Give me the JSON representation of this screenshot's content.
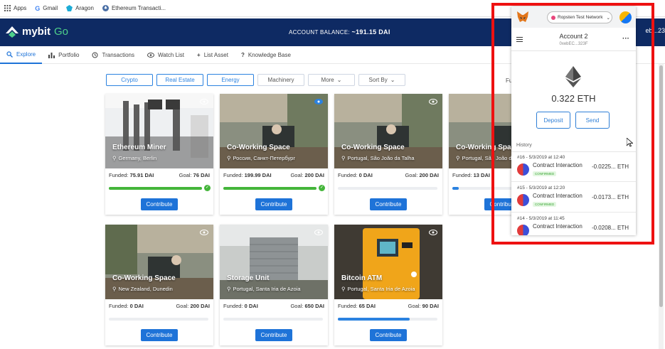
{
  "bookmarks": [
    {
      "label": "Apps",
      "icon": "apps-grid-icon"
    },
    {
      "label": "Gmail",
      "icon": "google-icon"
    },
    {
      "label": "Aragon",
      "icon": "aragon-icon"
    },
    {
      "label": "Ethereum Transacti...",
      "icon": "ethereum-icon"
    }
  ],
  "header": {
    "logo_text": "mybit",
    "logo_suffix": "Go",
    "balance_label": "ACCOUNT BALANCE:",
    "balance_value": "~191.15 DAI",
    "account_partial": "eb...23"
  },
  "nav": [
    {
      "label": "Explore",
      "icon": "search-icon",
      "active": true
    },
    {
      "label": "Portfolio",
      "icon": "bar-chart-icon"
    },
    {
      "label": "Transactions",
      "icon": "history-icon"
    },
    {
      "label": "Watch List",
      "icon": "eye-icon"
    },
    {
      "label": "List Asset",
      "icon": "plus-icon"
    },
    {
      "label": "Knowledge Base",
      "icon": "question-icon"
    }
  ],
  "filters": [
    {
      "label": "Crypto",
      "selected": true
    },
    {
      "label": "Real Estate",
      "selected": true
    },
    {
      "label": "Energy",
      "selected": true
    },
    {
      "label": "Machinery",
      "selected": false
    },
    {
      "label": "More",
      "selected": false,
      "dropdown": true
    },
    {
      "label": "Sort By",
      "selected": false,
      "dropdown": true
    }
  ],
  "filter_extra": "Fu",
  "cards": [
    {
      "title": "Ethereum Miner",
      "location": "Germany, Berlin",
      "funded_label": "Funded:",
      "funded": "75.91 DAI",
      "goal_label": "Goal:",
      "goal": "76 DAI",
      "progress": 0.999,
      "complete": true,
      "button": "Contribute",
      "image": "miner"
    },
    {
      "title": "Co-Working Space",
      "location": "Россия, Санкт-Петербург",
      "funded_label": "Funded:",
      "funded": "199.99 DAI",
      "goal_label": "Goal:",
      "goal": "200 DAI",
      "progress": 0.9999,
      "complete": true,
      "button": "Contribute",
      "image": "cowork",
      "watch": true
    },
    {
      "title": "Co-Working Space",
      "location": "Portugal, São João da Talha",
      "funded_label": "Funded:",
      "funded": "0 DAI",
      "goal_label": "Goal:",
      "goal": "200 DAI",
      "progress": 0,
      "complete": false,
      "button": "Contribute",
      "image": "cowork"
    },
    {
      "title": "Co-Working Space",
      "location": "Portugal, São João da T",
      "funded_label": "Funded:",
      "funded": "13 DAI",
      "goal_label": "Goal:",
      "goal": "",
      "progress": 0.065,
      "complete": false,
      "button": "Contribute",
      "image": "cowork"
    },
    {
      "title": "Co-Working Space",
      "location": "New Zealand, Dunedin",
      "funded_label": "Funded:",
      "funded": "0 DAI",
      "goal_label": "Goal:",
      "goal": "200 DAI",
      "progress": 0,
      "complete": false,
      "button": "Contribute",
      "image": "cowork"
    },
    {
      "title": "Storage Unit",
      "location": "Portugal, Santa Iria de Azoia",
      "funded_label": "Funded:",
      "funded": "0 DAI",
      "goal_label": "Goal:",
      "goal": "650 DAI",
      "progress": 0,
      "complete": false,
      "button": "Contribute",
      "image": "storage"
    },
    {
      "title": "Bitcoin ATM",
      "location": "Portugal, Santa Iria de Azoia",
      "funded_label": "Funded:",
      "funded": "65 DAI",
      "goal_label": "Goal:",
      "goal": "90 DAI",
      "progress": 0.722,
      "complete": false,
      "button": "Contribute",
      "image": "atm"
    }
  ],
  "metamask": {
    "network": "Ropsten Test Network",
    "account_name": "Account 2",
    "account_address": "0xebEC...323F",
    "balance": "0.322 ETH",
    "deposit": "Deposit",
    "send": "Send",
    "history_label": "History",
    "history": [
      {
        "date": "#16 - 5/3/2019 at 12:40",
        "type": "Contract Interaction",
        "status": "CONFIRMED",
        "amount": "-0.0225... ETH"
      },
      {
        "date": "#15 - 5/3/2019 at 12:20",
        "type": "Contract Interaction",
        "status": "CONFIRMED",
        "amount": "-0.0173... ETH"
      },
      {
        "date": "#14 - 5/3/2019 at 11:45",
        "type": "Contract Interaction",
        "status": "",
        "amount": "-0.0208... ETH"
      }
    ]
  },
  "colors": {
    "header": "#0e2a63",
    "accent": "#1e73d8",
    "progress_green": "#44b53a",
    "highlight_frame": "#ee1111"
  }
}
